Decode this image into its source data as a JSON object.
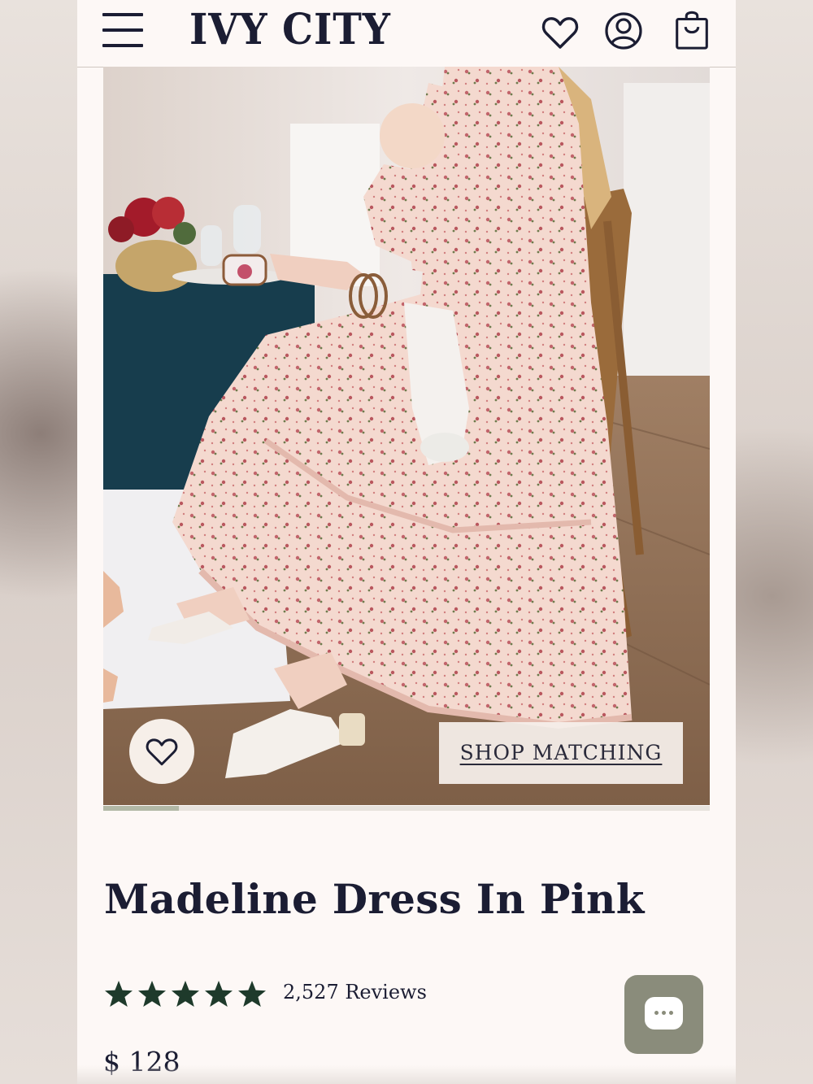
{
  "header": {
    "brand": "IVY CITY",
    "menu_icon": "hamburger-menu-icon",
    "wishlist_icon": "heart-icon",
    "account_icon": "user-icon",
    "cart_icon": "shopping-bag-icon"
  },
  "gallery": {
    "image_subject": "model in pink floral tiered dress holding baby at table",
    "favorite_icon": "heart-icon",
    "shop_matching_label": "SHOP MATCHING",
    "progress": 0.125
  },
  "product": {
    "title": "Madeline Dress In Pink",
    "rating": 5,
    "reviews_label": "2,527 Reviews",
    "price": "$ 128"
  },
  "chat": {
    "icon": "chat-bubble-icon"
  },
  "colors": {
    "navy": "#1b1d33",
    "background": "#fdf8f6",
    "star_green": "#1e3a2b",
    "chat_button": "#8a8c7b"
  }
}
